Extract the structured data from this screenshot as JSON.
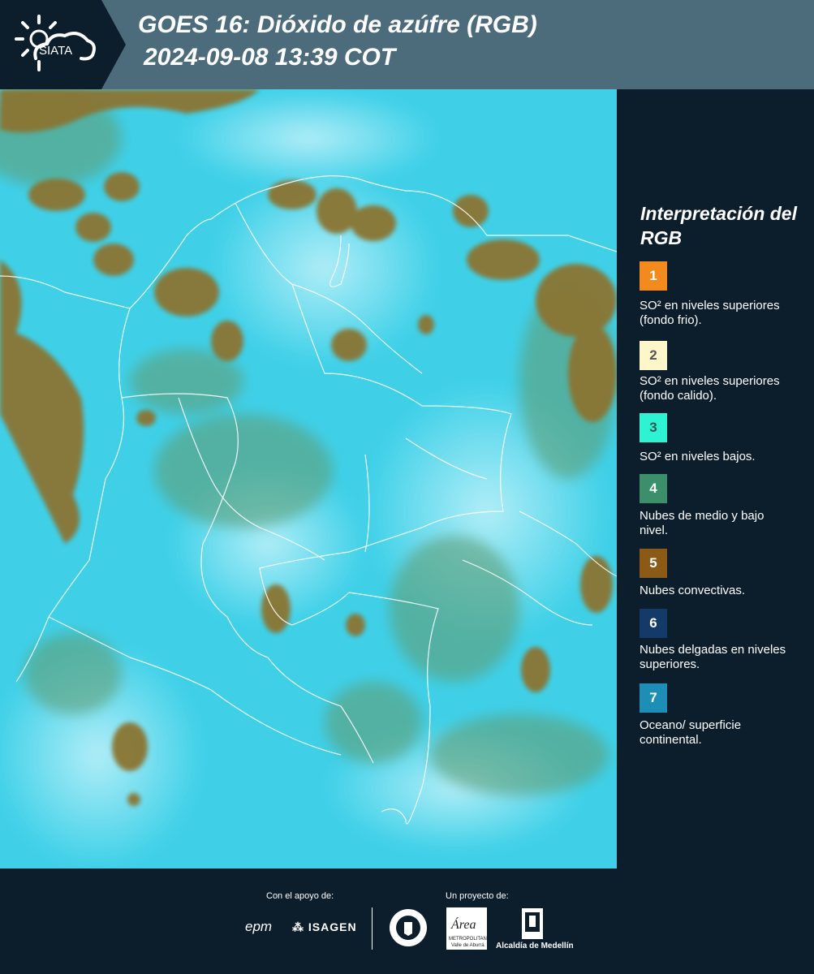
{
  "header": {
    "logo_text": "SIATA",
    "title_line1": "GOES 16: Dióxido de azúfre (RGB)",
    "title_line2": "2024-09-08 13:39 COT"
  },
  "legend": {
    "title": "Interpretación del RGB",
    "items": [
      {
        "number": "1",
        "color": "#f28a1e",
        "text": "SO² en niveles superiores (fondo frio)."
      },
      {
        "number": "2",
        "color": "#fdf6c8",
        "text": "SO² en niveles superiores (fondo calido)."
      },
      {
        "number": "3",
        "color": "#2ef3d3",
        "text": "SO² en niveles bajos."
      },
      {
        "number": "4",
        "color": "#3c8f6b",
        "text": "Nubes de medio y bajo nivel."
      },
      {
        "number": "5",
        "color": "#8a5a16",
        "text": "Nubes convectivas."
      },
      {
        "number": "6",
        "color": "#143a6a",
        "text": "Nubes delgadas en niveles superiores."
      },
      {
        "number": "7",
        "color": "#1d8fb6",
        "text": "Oceano/ superficie continental."
      }
    ]
  },
  "footer": {
    "support_label": "Con el apoyo de:",
    "project_label": "Un proyecto de:",
    "logos": [
      "epm",
      "ISAGEN",
      "Área Metropolitana Valle de Aburrá",
      "Alcaldía de Medellín"
    ]
  }
}
